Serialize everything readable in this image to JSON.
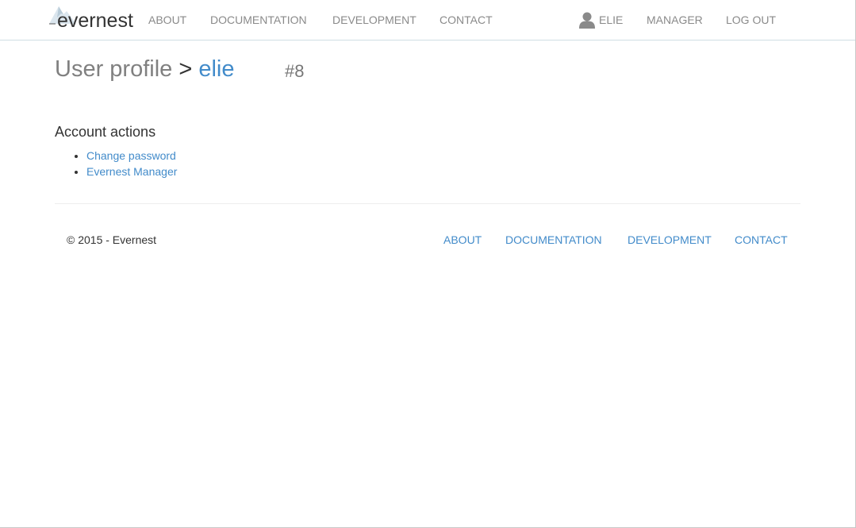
{
  "brand": {
    "name": "evernest",
    "logo_icon": "mountain-icon"
  },
  "nav": {
    "left_items": [
      {
        "label": "ABOUT"
      },
      {
        "label": "DOCUMENTATION"
      },
      {
        "label": "DEVELOPMENT"
      },
      {
        "label": "CONTACT"
      }
    ],
    "user": {
      "icon": "user-icon",
      "label": "ELIE"
    },
    "manager_label": "MANAGER",
    "logout_label": "LOG OUT"
  },
  "profile": {
    "title": "User profile",
    "separator": ">",
    "username": "elie",
    "user_id": "#8"
  },
  "actions": {
    "heading": "Account actions",
    "items": [
      {
        "label": "Change password"
      },
      {
        "label": "Evernest Manager"
      }
    ]
  },
  "footer": {
    "copyright": "© 2015 - Evernest",
    "links": [
      {
        "label": "ABOUT"
      },
      {
        "label": "DOCUMENTATION"
      },
      {
        "label": "DEVELOPMENT"
      },
      {
        "label": "CONTACT"
      }
    ]
  },
  "colors": {
    "link": "#428bca",
    "nav_text": "#8a8a8a",
    "title_grey": "#808080",
    "navbar_border": "#cfdee4"
  }
}
